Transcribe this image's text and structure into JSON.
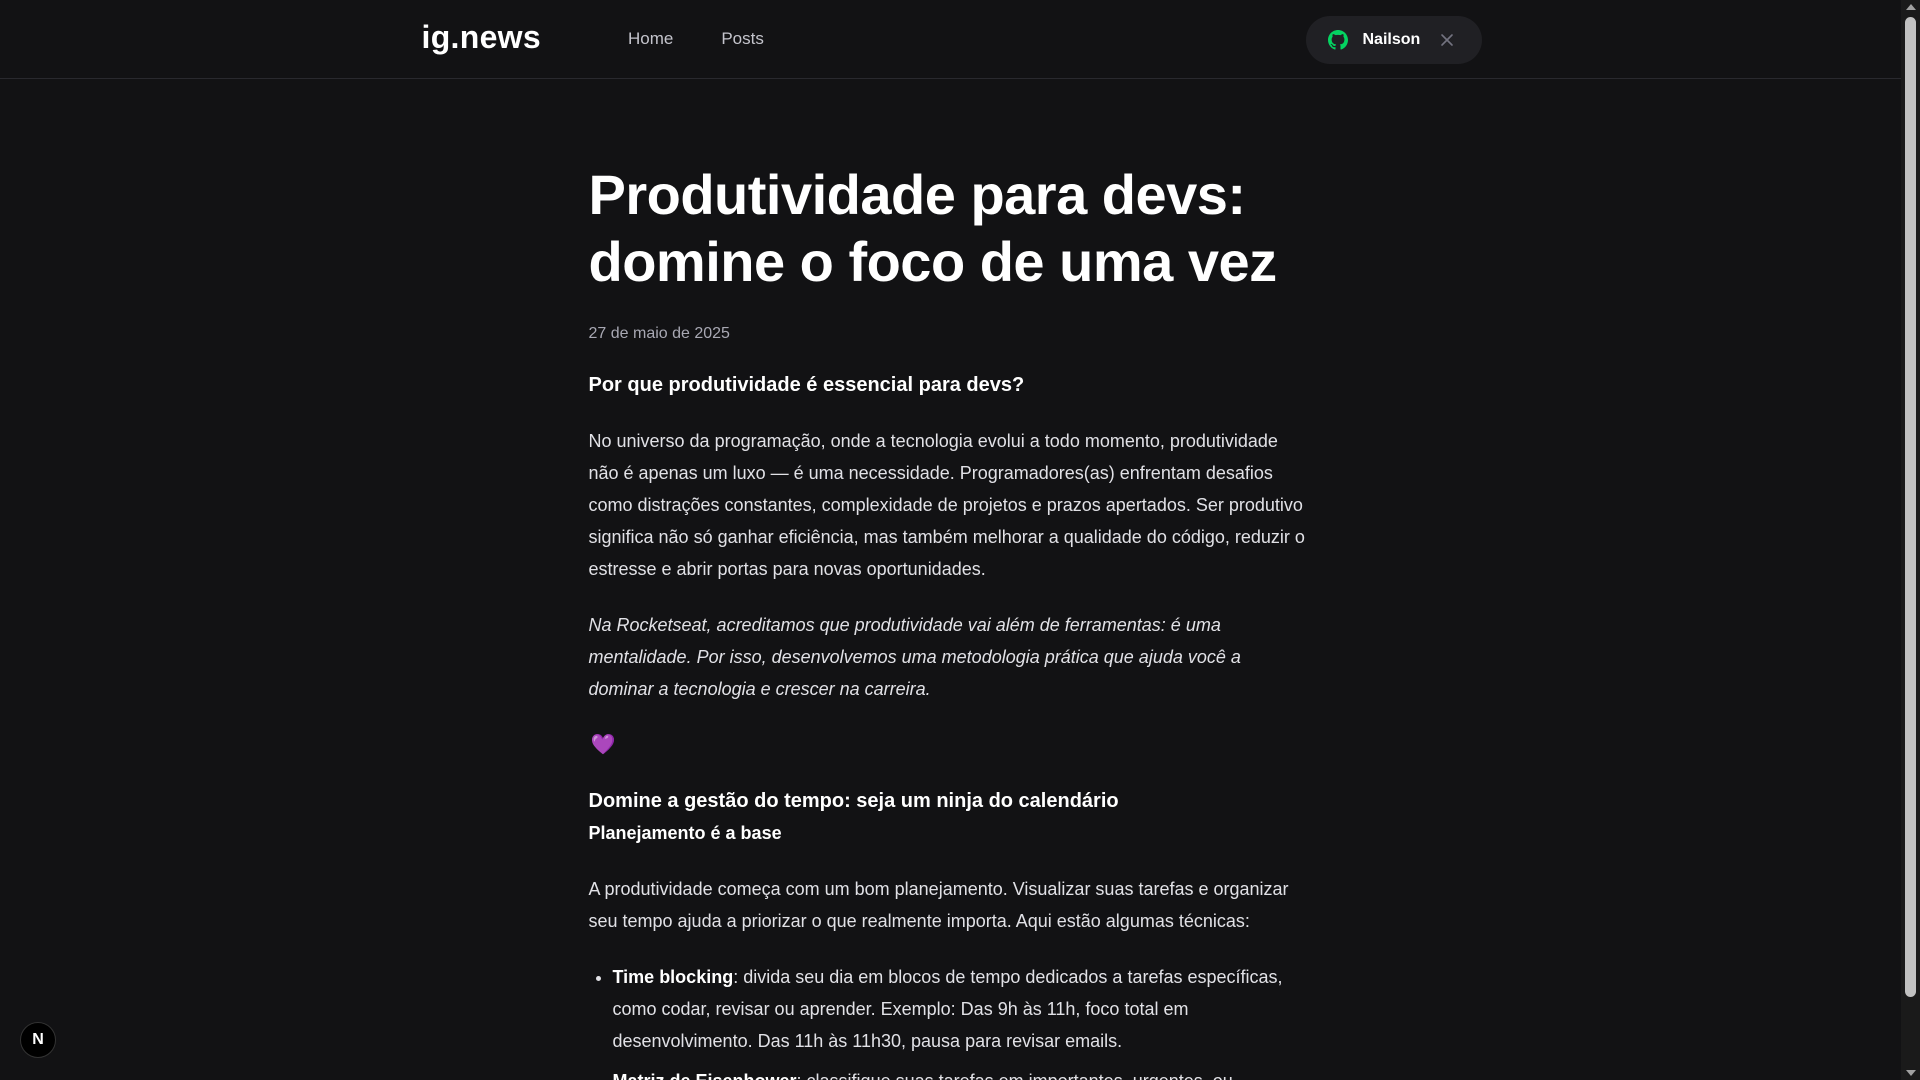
{
  "header": {
    "logo": "ig.news",
    "nav": [
      {
        "label": "Home"
      },
      {
        "label": "Posts"
      }
    ],
    "user": {
      "name": "Nailson",
      "icon": "github-icon",
      "icon_color": "#04d361"
    }
  },
  "post": {
    "title": "Produtividade para devs: domine o foco de uma vez",
    "date": "27 de maio de 2025",
    "h2_1": "Por que produtividade é essencial para devs?",
    "p1": "No universo da programação, onde a tecnologia evolui a todo momento, produtividade não é apenas um luxo — é uma necessidade. Programadores(as) enfrentam desafios como distrações constantes, complexidade de projetos e prazos apertados. Ser produtivo significa não só ganhar eficiência, mas também melhorar a qualidade do código, reduzir o estresse e abrir portas para novas oportunidades.",
    "p2": "Na Rocketseat, acreditamos que produtividade vai além de ferramentas: é uma mentalidade. Por isso, desenvolvemos uma metodologia prática que ajuda você a dominar a tecnologia e crescer na carreira.",
    "heart": "💜",
    "h2_2": "Domine a gestão do tempo: seja um ninja do calendário",
    "h3_1": "Planejamento é a base",
    "p3": "A produtividade começa com um bom planejamento. Visualizar suas tarefas e organizar seu tempo ajuda a priorizar o que realmente importa. Aqui estão algumas técnicas:",
    "list": [
      {
        "term": "Time blocking",
        "text": ": divida seu dia em blocos de tempo dedicados a tarefas específicas, como codar, revisar ou aprender. Exemplo: Das 9h às 11h, foco total em desenvolvimento. Das 11h às 11h30, pausa para revisar emails."
      },
      {
        "term": "Matriz de Eisenhower",
        "text": ": classifique suas tarefas em importantes, urgentes, ou"
      }
    ]
  },
  "badge": {
    "label": "N"
  },
  "colors": {
    "background": "#121214",
    "header_border": "#29292e",
    "accent_purple": "#8257e5",
    "accent_green": "#04d361"
  }
}
